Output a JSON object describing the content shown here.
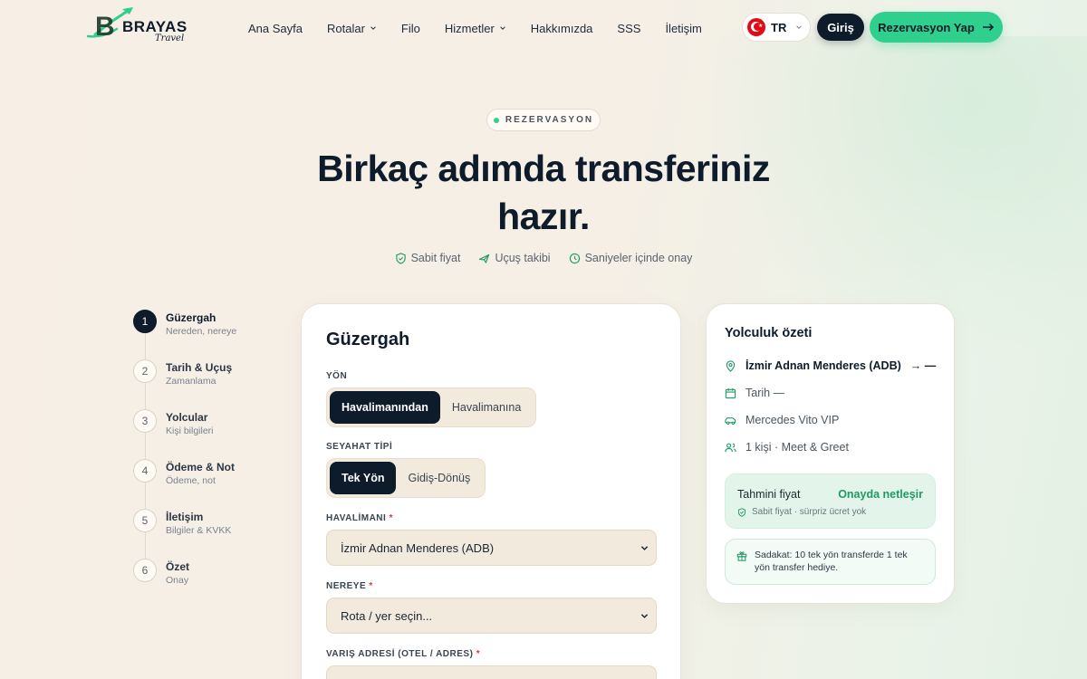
{
  "header": {
    "logo_text": "BRAYAS",
    "logo_script": "Travel",
    "nav": [
      {
        "label": "Ana Sayfa",
        "dropdown": false
      },
      {
        "label": "Rotalar",
        "dropdown": true
      },
      {
        "label": "Filo",
        "dropdown": false
      },
      {
        "label": "Hizmetler",
        "dropdown": true
      },
      {
        "label": "Hakkımızda",
        "dropdown": false
      },
      {
        "label": "SSS",
        "dropdown": false
      },
      {
        "label": "İletişim",
        "dropdown": false
      }
    ],
    "language": "TR",
    "login_label": "Giriş",
    "reserve_label": "Rezervasyon Yap"
  },
  "hero": {
    "eyebrow": "REZERVASYON",
    "title_line1": "Birkaç adımda transferiniz",
    "title_line2": "hazır.",
    "features": [
      "Sabit fiyat",
      "Uçuş takibi",
      "Saniyeler içinde onay"
    ]
  },
  "steps": [
    {
      "num": "1",
      "title": "Güzergah",
      "sub": "Nereden, nereye",
      "active": true
    },
    {
      "num": "2",
      "title": "Tarih & Uçuş",
      "sub": "Zamanlama",
      "active": false
    },
    {
      "num": "3",
      "title": "Yolcular",
      "sub": "Kişi bilgileri",
      "active": false
    },
    {
      "num": "4",
      "title": "Ödeme & Not",
      "sub": "Ödeme, not",
      "active": false
    },
    {
      "num": "5",
      "title": "İletişim",
      "sub": "Bilgiler & KVKK",
      "active": false
    },
    {
      "num": "6",
      "title": "Özet",
      "sub": "Onay",
      "active": false
    }
  ],
  "form": {
    "title": "Güzergah",
    "direction_label": "YÖN",
    "direction_options": [
      "Havalimanından",
      "Havalimanına"
    ],
    "direction_selected": "Havalimanından",
    "trip_label": "SEYAHAT TİPİ",
    "trip_options": [
      "Tek Yön",
      "Gidiş-Dönüş"
    ],
    "trip_selected": "Tek Yön",
    "airport_label": "HAVALİMANI",
    "airport_value": "İzmir Adnan Menderes (ADB)",
    "to_label": "NEREYE",
    "to_value": "Rota / yer seçin...",
    "address_label": "VARIŞ ADRESİ (OTEL / ADRES)",
    "required_mark": "*"
  },
  "summary": {
    "title": "Yolculuk özeti",
    "route_from": "İzmir Adnan Menderes (ADB)",
    "route_to": "→ —",
    "date": "Tarih —",
    "vehicle": "Mercedes Vito VIP",
    "passengers": "1 kişi · Meet & Greet",
    "price_label": "Tahmini fiyat",
    "price_value": "Onayda netleşir",
    "price_note": "Sabit fiyat · sürpriz ücret yok",
    "loyalty": "Sadakat: 10 tek yön transferde 1 tek yön transfer hediye."
  },
  "colors": {
    "primary": "#0d1b2a",
    "accent": "#2fcf8e",
    "accent_text": "#1f9a63"
  },
  "icons": [
    "plane-logo-icon",
    "chevron-down-icon",
    "arrow-right-icon",
    "shield-check-icon",
    "plane-icon",
    "clock-icon",
    "map-pin-icon",
    "calendar-icon",
    "car-icon",
    "users-icon",
    "gift-icon"
  ]
}
